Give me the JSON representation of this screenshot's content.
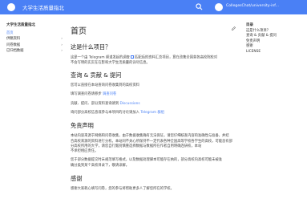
{
  "header": {
    "title": "大学生活质量指北",
    "repo": "CollegesChat/university-inf..."
  },
  "sidebar": {
    "title": "大学生活质量指北",
    "items": [
      {
        "label": "首页",
        "has_children": false,
        "active": true
      },
      {
        "label": "供稿资料",
        "has_children": true,
        "active": false
      },
      {
        "label": "问卷数据",
        "has_children": true,
        "active": false
      },
      {
        "label": "已归档数据",
        "has_children": true,
        "active": false
      }
    ]
  },
  "main": {
    "page_title": "首页",
    "sec1_title": "这是什么项目？",
    "sec1_p1_part1": "这是一个由 Telegram 频道发起的调查",
    "sec1_p1_part2": "匹配后的资料汇总项目，意在改集全国普各高校院校对",
    "sec1_p1_line2": "不会写明的实实在在影响大学生活质量的详尽信息。",
    "sec2_title": "查询 & 贡献 & 提问",
    "sec2_p1": "您可以直接在本站查询问卷收集到的高校资料",
    "sec2_p2_part1": "填写调查问卷请移步",
    "sec2_p2_link": "调查问卷",
    "sec2_p3_part1": "贡献、提问、部分资料查询请到",
    "sec2_p3_link": "Discussions",
    "sec2_p4_part1": "询问部分高校信息或参与本项目的讨论请加入",
    "sec2_p4_link": "Telegram 群组",
    "sec3_title": "免责声明",
    "sec3_p1_line1": "本站内容来源于网络和问卷收集，由于数据收集确有无法保证，请您仔细核查内容的准确性与准备，并结",
    "sec3_p1_line2": "合高校来源的资料进行分析。本站同不关心所保持不一定代表各种全国高等学校各学生的高校，可能含有部",
    "sec3_p1_line3": "分高校所用的大学，请您自行甄别慎重选择数据与数据所在作者自用明确连研校，本站",
    "sec3_p1_line4": "不承担相应责任。",
    "sec3_p2_line1": "您于部分数据提交时未规范填写格式，以及数据处理脚本可能存在纳的，部分高校内高校可能未被准",
    "sec3_p2_line2": "确分类到某个高校目录下，敬请谅解。",
    "sec4_title": "感谢",
    "sec4_p1": "感谢大家耗心填写问卷，您的参与将帮助更多人了解您所在的学校。"
  },
  "toc": {
    "title": "目录",
    "items": [
      "这是什么项目？",
      "查询 & 贡献 & 提问",
      "免责声明",
      "感谢",
      "LICENSE"
    ]
  }
}
